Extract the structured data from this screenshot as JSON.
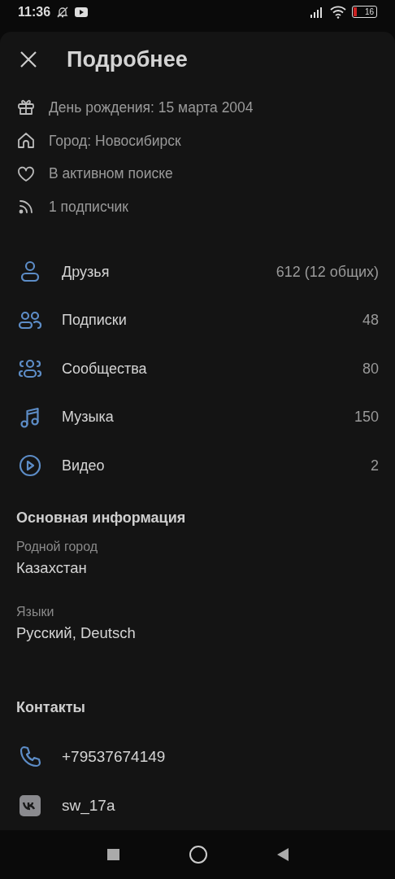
{
  "status_bar": {
    "time": "11:36",
    "battery": "16"
  },
  "header": {
    "title": "Подробнее"
  },
  "info": [
    {
      "kind": "gift",
      "text": "День рождения: 15 марта 2004"
    },
    {
      "kind": "home",
      "text": "Город: Новосибирск"
    },
    {
      "kind": "heart",
      "text": "В активном поиске"
    },
    {
      "kind": "feed",
      "text": "1 подписчик"
    }
  ],
  "counters": [
    {
      "kind": "person",
      "label": "Друзья",
      "count": "612 (12 общих)"
    },
    {
      "kind": "people",
      "label": "Подписки",
      "count": "48"
    },
    {
      "kind": "group",
      "label": "Сообщества",
      "count": "80"
    },
    {
      "kind": "music",
      "label": "Музыка",
      "count": "150"
    },
    {
      "kind": "video",
      "label": "Видео",
      "count": "2"
    }
  ],
  "main_info": {
    "title": "Основная информация",
    "fields": [
      {
        "label": "Родной город",
        "value": "Казахстан"
      },
      {
        "label": "Языки",
        "value": "Русский, Deutsch"
      }
    ]
  },
  "contacts": {
    "title": "Контакты",
    "items": [
      {
        "kind": "phone",
        "text": "+79537674149"
      },
      {
        "kind": "vk",
        "text": "sw_17a"
      }
    ]
  }
}
